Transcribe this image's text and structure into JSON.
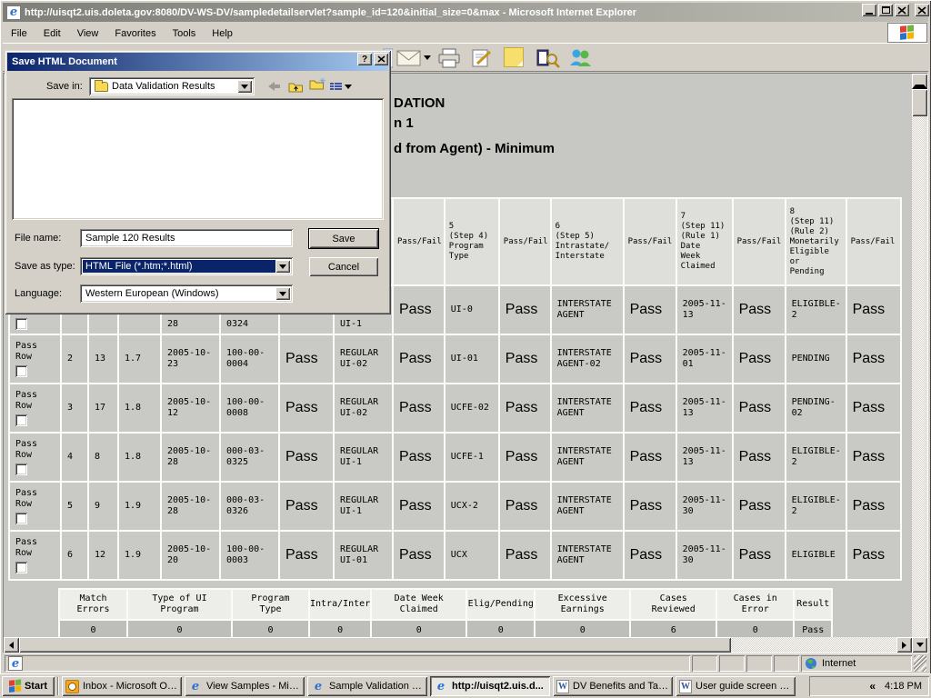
{
  "window": {
    "title": "http://uisqt2.uis.doleta.gov:8080/DV-WS-DV/sampledetailservlet?sample_id=120&initial_size=0&max - Microsoft Internet Explorer",
    "menu": [
      "File",
      "Edit",
      "View",
      "Favorites",
      "Tools",
      "Help"
    ]
  },
  "dialog": {
    "title": "Save HTML Document",
    "help_button": "?",
    "save_in": {
      "label": "Save in:",
      "value": "Data Validation Results"
    },
    "file_name": {
      "label": "File name:",
      "value": "Sample 120 Results"
    },
    "save_as_type": {
      "label": "Save as type:",
      "value": "HTML File (*.htm;*.html)"
    },
    "language": {
      "label": "Language:",
      "value": "Western European (Windows)"
    },
    "buttons": {
      "save": "Save",
      "cancel": "Cancel"
    }
  },
  "page": {
    "heading_fragment_1": "DATION",
    "heading_fragment_2": "n 1",
    "heading_fragment_3": "d from Agent) - Minimum"
  },
  "table": {
    "headers": [
      "",
      "",
      "",
      "",
      "",
      "",
      "",
      "",
      "Pass/Fail",
      "5\n(Step 4)\nProgram\nType",
      "Pass/Fail",
      "6\n(Step 5)\nIntrastate/\nInterstate",
      "Pass/Fail",
      "7\n(Step 11)\n(Rule 1)\nDate\nWeek\nClaimed",
      "Pass/Fail",
      "8\n(Step 11)\n(Rule 2)\nMonetarily\nEligible\nor\nPending",
      "Pass/Fail"
    ],
    "rows": [
      {
        "bottomAlign": true,
        "cells": [
          "",
          "",
          "",
          "",
          "28",
          "0324",
          "",
          "UI-1",
          "Pass",
          "UI-0",
          "Pass",
          "INTERSTATE\nAGENT",
          "Pass",
          "2005-11-\n13",
          "Pass",
          "ELIGIBLE-\n2",
          "Pass"
        ]
      },
      {
        "cells": [
          "Pass\nRow",
          "2",
          "13",
          "1.7",
          "2005-10-\n23",
          "100-00-\n0004",
          "Pass",
          "REGULAR\nUI-02",
          "Pass",
          "UI-01",
          "Pass",
          "INTERSTATE\nAGENT-02",
          "Pass",
          "2005-11-\n01",
          "Pass",
          "PENDING",
          "Pass"
        ]
      },
      {
        "cells": [
          "Pass\nRow",
          "3",
          "17",
          "1.8",
          "2005-10-\n12",
          "100-00-\n0008",
          "Pass",
          "REGULAR\nUI-02",
          "Pass",
          "UCFE-02",
          "Pass",
          "INTERSTATE\nAGENT",
          "Pass",
          "2005-11-\n13",
          "Pass",
          "PENDING-\n02",
          "Pass"
        ]
      },
      {
        "cells": [
          "Pass\nRow",
          "4",
          "8",
          "1.8",
          "2005-10-\n28",
          "000-03-\n0325",
          "Pass",
          "REGULAR\nUI-1",
          "Pass",
          "UCFE-1",
          "Pass",
          "INTERSTATE\nAGENT",
          "Pass",
          "2005-11-\n13",
          "Pass",
          "ELIGIBLE-\n2",
          "Pass"
        ]
      },
      {
        "cells": [
          "Pass\nRow",
          "5",
          "9",
          "1.9",
          "2005-10-\n28",
          "000-03-\n0326",
          "Pass",
          "REGULAR\nUI-1",
          "Pass",
          "UCX-2",
          "Pass",
          "INTERSTATE\nAGENT",
          "Pass",
          "2005-11-\n30",
          "Pass",
          "ELIGIBLE-\n2",
          "Pass"
        ]
      },
      {
        "cells": [
          "Pass\nRow",
          "6",
          "12",
          "1.9",
          "2005-10-\n20",
          "100-00-\n0003",
          "Pass",
          "REGULAR\nUI-01",
          "Pass",
          "UCX",
          "Pass",
          "INTERSTATE\nAGENT",
          "Pass",
          "2005-11-\n30",
          "Pass",
          "ELIGIBLE",
          "Pass"
        ]
      }
    ]
  },
  "summary": {
    "columns": [
      {
        "label": "Match\nErrors",
        "value": "0"
      },
      {
        "label": "Type of UI\nProgram",
        "value": "0"
      },
      {
        "label": "Program\nType",
        "value": "0"
      },
      {
        "label": "Intra/Inter",
        "value": "0"
      },
      {
        "label": "Date Week\nClaimed",
        "value": "0"
      },
      {
        "label": "Elig/Pending",
        "value": "0"
      },
      {
        "label": "Excessive\nEarnings",
        "value": "0"
      },
      {
        "label": "Cases\nReviewed",
        "value": "6"
      },
      {
        "label": "Cases in\nError",
        "value": "0"
      },
      {
        "label": "Result",
        "value": "Pass"
      }
    ]
  },
  "statusbar": {
    "zone": "Internet"
  },
  "taskbar": {
    "start": "Start",
    "buttons": [
      {
        "icon": "outlook",
        "label": "Inbox - Microsoft Ou..."
      },
      {
        "icon": "ie",
        "label": "View Samples - Micro..."
      },
      {
        "icon": "ie",
        "label": "Sample Validation - M..."
      },
      {
        "icon": "ie",
        "label": "http://uisqt2.uis.d...",
        "active": true
      },
      {
        "icon": "word",
        "label": "DV Benefits and Tax ..."
      },
      {
        "icon": "word",
        "label": "User guide screen sh..."
      }
    ],
    "tray": {
      "chevron": "«",
      "time": "4:18 PM"
    }
  },
  "icons": {
    "ie": "e",
    "word": "W"
  }
}
